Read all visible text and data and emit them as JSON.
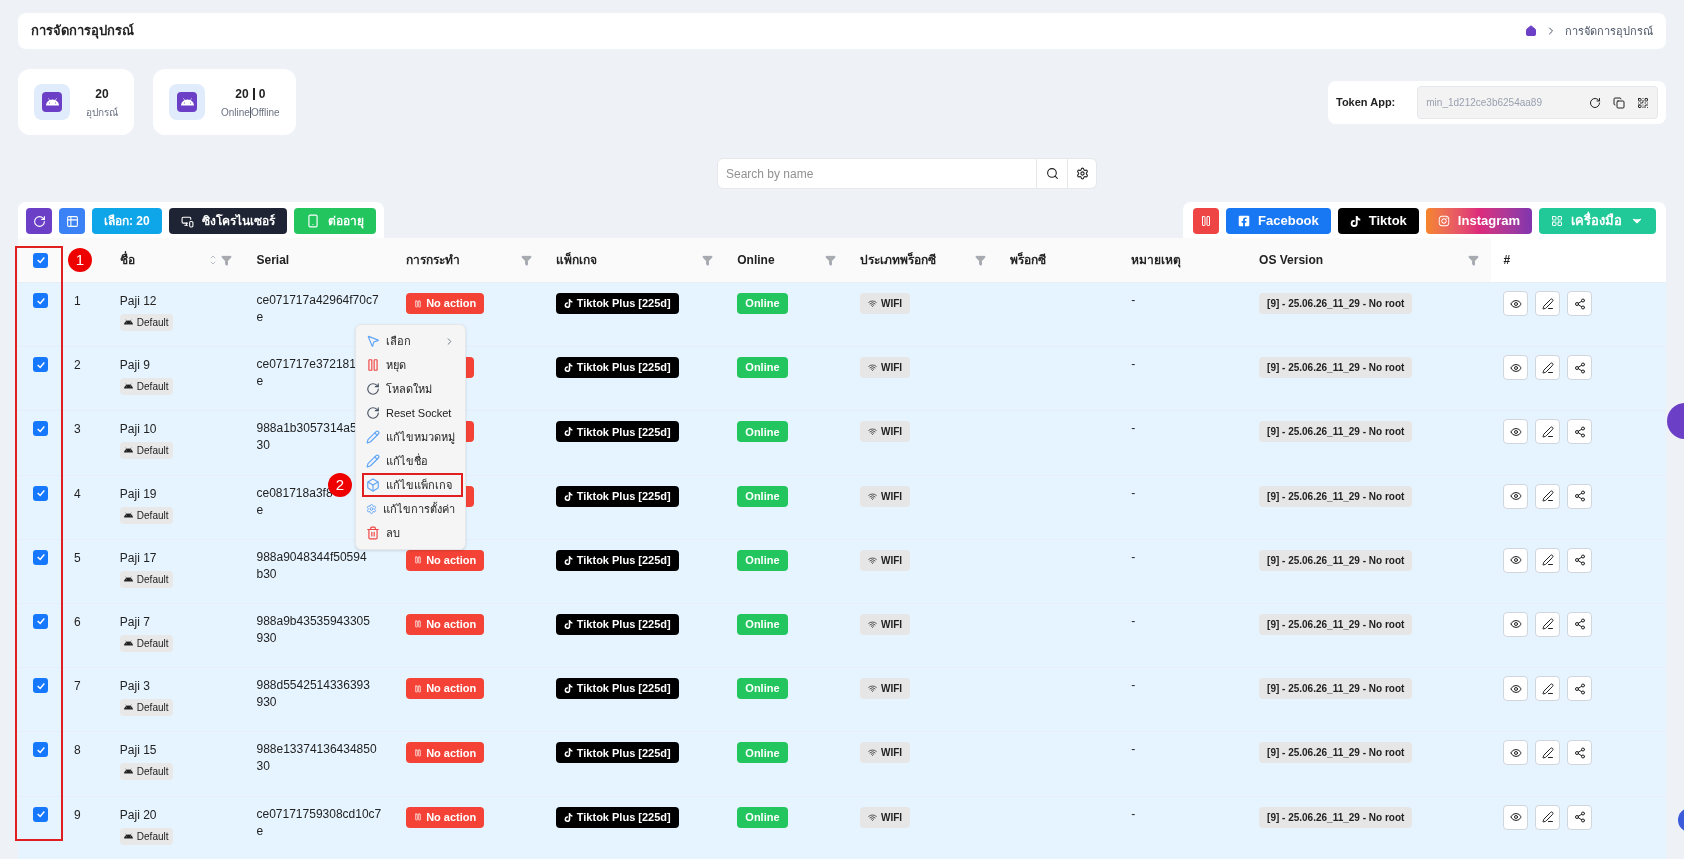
{
  "header": {
    "title": "การจัดการอุปกรณ์",
    "breadcrumb": [
      {
        "kind": "home"
      },
      {
        "kind": "text",
        "label": "การจัดการอุปกรณ์"
      }
    ]
  },
  "stats": [
    {
      "values": [
        "20"
      ],
      "labels": [
        "อุปกรณ์"
      ]
    },
    {
      "values": [
        "20",
        "0"
      ],
      "labels": [
        "Online",
        "Offline"
      ]
    }
  ],
  "token": {
    "label": "Token App:",
    "value": "min_1d212ce3b6254aa89"
  },
  "search": {
    "placeholder": "Search by name"
  },
  "toolbar_left": [
    {
      "kind": "refresh"
    },
    {
      "kind": "grid"
    },
    {
      "kind": "select",
      "label": "เลือก: 20"
    },
    {
      "kind": "sync",
      "label": "ซิงโครไนเซอร์"
    },
    {
      "kind": "renew",
      "label": "ต่ออายุ"
    }
  ],
  "toolbar_right": [
    {
      "kind": "pause"
    },
    {
      "kind": "facebook",
      "label": "Facebook"
    },
    {
      "kind": "tiktok",
      "label": "Tiktok"
    },
    {
      "kind": "instagram",
      "label": "Instagram"
    },
    {
      "kind": "tools",
      "label": "เครื่องมือ"
    }
  ],
  "table": {
    "all_checked": true,
    "columns": [
      {
        "label": "ชื่อ",
        "sort": true,
        "filter": true
      },
      {
        "label": "Serial",
        "sort": false,
        "filter": false
      },
      {
        "label": "การกระทำ",
        "sort": false,
        "filter": true
      },
      {
        "label": "แพ็กเกจ",
        "sort": false,
        "filter": true
      },
      {
        "label": "Online",
        "sort": false,
        "filter": true
      },
      {
        "label": "ประเภทพร็อกซี",
        "sort": false,
        "filter": true
      },
      {
        "label": "พร็อกซี",
        "sort": false,
        "filter": false
      },
      {
        "label": "หมายเหตุ",
        "sort": false,
        "filter": false
      },
      {
        "label": "OS Version",
        "sort": false,
        "filter": true
      },
      {
        "label": "#",
        "sort": false,
        "filter": false
      }
    ],
    "rows": [
      {
        "checked": true,
        "number": "1",
        "name": "Paji 12",
        "tag": "Default",
        "serial": [
          "ce071717a42964f70c7",
          "e"
        ],
        "action": "No action",
        "package": "Tiktok Plus [225d]",
        "online": "Online",
        "proxy_type": "WIFI",
        "note": "-",
        "os": "[9] - 25.06.26_11_29 - No root"
      },
      {
        "checked": true,
        "number": "2",
        "name": "Paji 9",
        "tag": "Default",
        "serial": [
          "ce071717e372181",
          "e"
        ],
        "package": "Tiktok Plus [225d]",
        "online": "Online",
        "proxy_type": "WIFI",
        "note": "-",
        "os": "[9] - 25.06.26_11_29 - No root"
      },
      {
        "checked": true,
        "number": "3",
        "name": "Paji 10",
        "tag": "Default",
        "serial": [
          "988a1b3057314a5",
          "30"
        ],
        "package": "Tiktok Plus [225d]",
        "online": "Online",
        "proxy_type": "WIFI",
        "note": "-",
        "os": "[9] - 25.06.26_11_29 - No root"
      },
      {
        "checked": true,
        "number": "4",
        "name": "Paji 19",
        "tag": "Default",
        "serial": [
          "ce081718a3f8",
          "e"
        ],
        "package": "Tiktok Plus [225d]",
        "online": "Online",
        "proxy_type": "WIFI",
        "note": "-",
        "os": "[9] - 25.06.26_11_29 - No root"
      },
      {
        "checked": true,
        "number": "5",
        "name": "Paji 17",
        "tag": "Default",
        "serial": [
          "988a9048344f50594",
          "b30"
        ],
        "action": "No action",
        "package": "Tiktok Plus [225d]",
        "online": "Online",
        "proxy_type": "WIFI",
        "note": "-",
        "os": "[9] - 25.06.26_11_29 - No root"
      },
      {
        "checked": true,
        "number": "6",
        "name": "Paji 7",
        "tag": "Default",
        "serial": [
          "988a9b43535943305",
          "930"
        ],
        "action": "No action",
        "package": "Tiktok Plus [225d]",
        "online": "Online",
        "proxy_type": "WIFI",
        "note": "-",
        "os": "[9] - 25.06.26_11_29 - No root"
      },
      {
        "checked": true,
        "number": "7",
        "name": "Paji 3",
        "tag": "Default",
        "serial": [
          "988d5542514336393",
          "930"
        ],
        "action": "No action",
        "package": "Tiktok Plus [225d]",
        "online": "Online",
        "proxy_type": "WIFI",
        "note": "-",
        "os": "[9] - 25.06.26_11_29 - No root"
      },
      {
        "checked": true,
        "number": "8",
        "name": "Paji 15",
        "tag": "Default",
        "serial": [
          "988e13374136434850",
          "30"
        ],
        "action": "No action",
        "package": "Tiktok Plus [225d]",
        "online": "Online",
        "proxy_type": "WIFI",
        "note": "-",
        "os": "[9] - 25.06.26_11_29 - No root"
      },
      {
        "checked": true,
        "number": "9",
        "name": "Paji 20",
        "tag": "Default",
        "serial": [
          "ce07171759308cd10c7",
          "e"
        ],
        "action": "No action",
        "package": "Tiktok Plus [225d]",
        "online": "Online",
        "proxy_type": "WIFI",
        "note": "-",
        "os": "[9] - 25.06.26_11_29 - No root"
      }
    ]
  },
  "context_menu": [
    {
      "kind": "select",
      "label": "เลือก",
      "submenu": true,
      "highlighted": false
    },
    {
      "kind": "stop",
      "label": "หยุด",
      "submenu": false,
      "highlighted": false
    },
    {
      "kind": "reload",
      "label": "โหลดใหม่",
      "submenu": false,
      "highlighted": false
    },
    {
      "kind": "reload",
      "label": "Reset Socket",
      "submenu": false,
      "highlighted": false
    },
    {
      "kind": "edit",
      "label": "แก้ไขหมวดหมู่",
      "submenu": false,
      "highlighted": false
    },
    {
      "kind": "edit",
      "label": "แก้ไขชื่อ",
      "submenu": false,
      "highlighted": false
    },
    {
      "kind": "package",
      "label": "แก้ไขแพ็กเกจ",
      "submenu": false,
      "highlighted": true
    },
    {
      "kind": "settings",
      "label": "แก้ไขการตั้งค่า",
      "submenu": false,
      "highlighted": false
    },
    {
      "kind": "delete",
      "label": "ลบ",
      "submenu": false,
      "highlighted": false
    }
  ],
  "annotations": [
    {
      "label": "1"
    },
    {
      "label": "2"
    }
  ]
}
